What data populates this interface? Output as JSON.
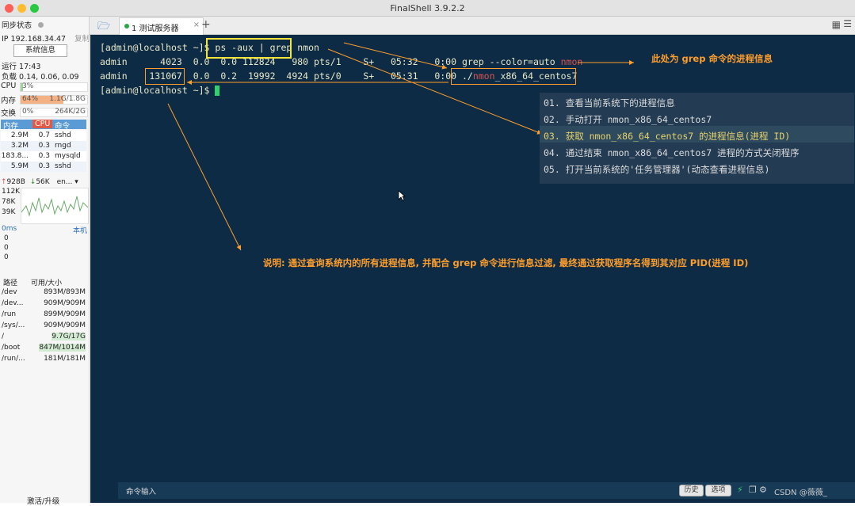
{
  "window": {
    "title": "FinalShell 3.9.2.2"
  },
  "sidebar": {
    "sync_status": "同步状态",
    "ip": "IP 192.168.34.47",
    "copy": "复制",
    "sysinfo_button": "系统信息",
    "uptime": "运行 17:43",
    "load": "负载 0.14, 0.06, 0.09",
    "cpu": {
      "label": "CPU",
      "percent": "3%",
      "value": 0.03
    },
    "mem": {
      "label": "内存",
      "percent": "64%",
      "used": "1.1G/1.8G",
      "value": 0.64
    },
    "swap": {
      "label": "交换",
      "percent": "0%",
      "used": "264K/2G",
      "value": 0.0
    },
    "proc_headers": [
      "内存",
      "CPU",
      "命令"
    ],
    "processes": [
      {
        "mem": "2.9M",
        "cpu": "0.7",
        "cmd": "sshd"
      },
      {
        "mem": "3.2M",
        "cpu": "0.3",
        "cmd": "rngd"
      },
      {
        "mem": "183.8...",
        "cpu": "0.3",
        "cmd": "mysqld"
      },
      {
        "mem": "5.9M",
        "cpu": "0.3",
        "cmd": "sshd"
      }
    ],
    "net": {
      "up": "928B",
      "down": "56K",
      "iface": "en...",
      "scale": [
        "112K",
        "78K",
        "39K"
      ]
    },
    "latency": {
      "label": "0ms",
      "host": "本机",
      "values": [
        "0",
        "0",
        "0"
      ]
    },
    "fs_headers": [
      "路径",
      "可用/大小"
    ],
    "filesystems": [
      {
        "path": "/dev",
        "size": "893M/893M"
      },
      {
        "path": "/dev...",
        "size": "909M/909M"
      },
      {
        "path": "/run",
        "size": "899M/909M"
      },
      {
        "path": "/sys/...",
        "size": "909M/909M"
      },
      {
        "path": "/",
        "size": "9.7G/17G"
      },
      {
        "path": "/boot",
        "size": "847M/1014M"
      },
      {
        "path": "/run/...",
        "size": "181M/181M"
      }
    ],
    "upgrade": "激活/升级"
  },
  "tab": {
    "label": "1 测试服务器"
  },
  "terminal": {
    "line1_prompt": "[admin@localhost ~]$ ",
    "line1_cmd": "ps -aux | grep ",
    "line1_arg": "nmon",
    "line2": "admin      4023  0.0  0.0 112824   980 pts/1    S+   05:32   0:00 grep --color=auto ",
    "line2_red": "nmon",
    "line3_user": "admin    ",
    "line3_pid": "131067",
    "line3_rest": "  0.0  0.2  19992  4924 pts/0    S+   05:31   0:00 ",
    "line3_path_prefix": "./",
    "line3_path_red": "nmon",
    "line3_path_suffix": "_x86_64_centos7",
    "line4_prompt": "[admin@localhost ~]$ "
  },
  "menu": [
    "01. 查看当前系统下的进程信息",
    "02. 手动打开 nmon_x86_64_centos7",
    "03. 获取 nmon_x86_64_centos7 的进程信息(进程 ID)",
    "04. 通过结束 nmon_x86_64_centos7 进程的方式关闭程序",
    "05. 打开当前系统的'任务管理器'(动态查看进程信息)"
  ],
  "annotations": {
    "grep_note": "此处为 grep 命令的进程信息",
    "explain": "说明: 通过查询系统内的所有进程信息, 并配合 grep 命令进行信息过滤, 最终通过获取程序名得到其对应 PID(进程 ID)"
  },
  "cmdbar": {
    "input_label": "命令输入",
    "history": "历史",
    "options": "选项",
    "watermark": "CSDN @薇薇_"
  },
  "colors": {
    "terminal_bg": "#0d2b45",
    "annotation": "#ff9e2c",
    "highlight_box": "#f3e33b",
    "match_red": "#d9534f"
  }
}
